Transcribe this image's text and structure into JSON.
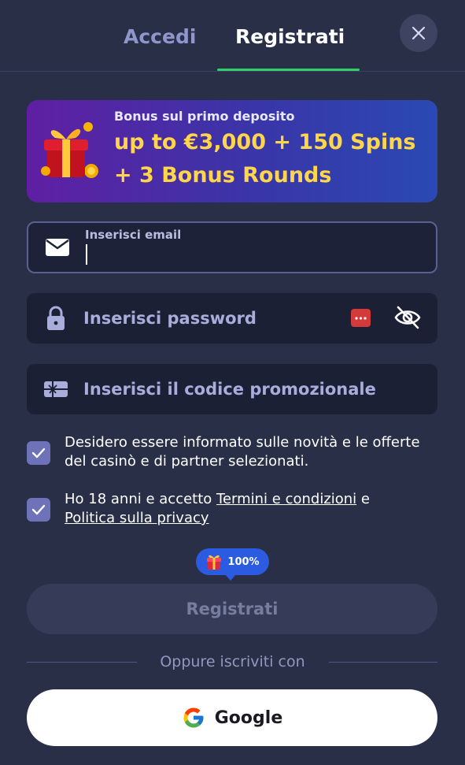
{
  "tabs": {
    "login_label": "Accedi",
    "register_label": "Registrati",
    "active": "Registrati"
  },
  "banner": {
    "kicker": "Bonus sul primo deposito",
    "headline_line1": "up to €3,000 + 150 Spins",
    "headline_line2": "+ 3 Bonus Rounds",
    "icon": "gift-box-icon"
  },
  "form": {
    "email": {
      "label": "Inserisci email",
      "value": "",
      "icon": "envelope-icon"
    },
    "password": {
      "placeholder": "Inserisci password",
      "icon": "lock-icon"
    },
    "promo": {
      "placeholder": "Inserisci il codice promozionale",
      "icon": "gift-card-icon"
    }
  },
  "consents": {
    "marketing": {
      "text": "Desidero essere informato sulle novità e le offerte del casinò e di partner selezionati.",
      "checked": true
    },
    "terms": {
      "prefix": "Ho 18 anni e accetto ",
      "terms_link": "Termini e condizioni",
      "joiner": " e",
      "privacy_link": "Politica sulla privacy",
      "checked": true
    }
  },
  "progress_bubble": {
    "text": "100%"
  },
  "submit": {
    "label": "Registrati"
  },
  "alt_signup": {
    "divider_text": "Oppure iscriviti con",
    "google_label": "Google"
  },
  "colors": {
    "background": "#2a2f48",
    "accent_green": "#2fd06a",
    "banner_yellow": "#ffd54a",
    "bubble_blue": "#2b5be0",
    "checkbox": "#6e72b8"
  }
}
